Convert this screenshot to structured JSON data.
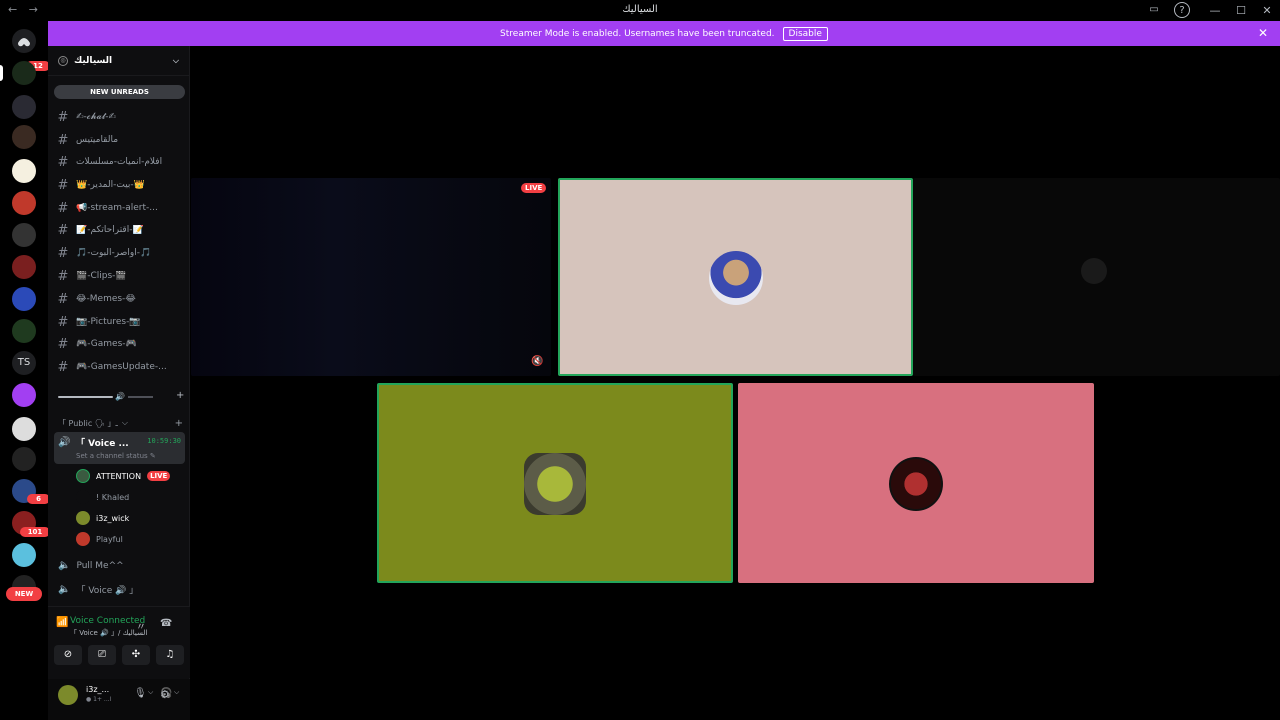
{
  "window": {
    "title": "السياليك",
    "nav_icons": "← →",
    "controls": [
      "—",
      "☐",
      "✕"
    ]
  },
  "banner": {
    "text": "Streamer Mode is enabled. Usernames have been truncated.",
    "disable_label": "Disable",
    "close": "✕",
    "color": "#a23ff2"
  },
  "server_list": {
    "badges": [
      "12",
      "6",
      "101"
    ],
    "ts_label": "TS",
    "new_label": "NEW"
  },
  "guild": {
    "name": "السياليك",
    "new_unreads": "NEW UNREADS"
  },
  "channels": [
    {
      "name": "✍-𝓬𝓱𝓪𝓽-✍"
    },
    {
      "name": "مالقاميتيس"
    },
    {
      "name": "أفلام-انميات-مسلسلات"
    },
    {
      "name": "👑-بيت-المدير-👑"
    },
    {
      "name": "📢-stream-alert-..."
    },
    {
      "name": "📝-اقتراحاتكم-📝"
    },
    {
      "name": "🎵-اواصر-البوت-🎵"
    },
    {
      "name": "🎬-Clips-🎬"
    },
    {
      "name": "😂-Memes-😂"
    },
    {
      "name": "📷-Pictures-📷"
    },
    {
      "name": "🎮-Games-🎮"
    },
    {
      "name": "🎮-GamesUpdate-..."
    }
  ],
  "category": {
    "name": "「 Public 🗣 」ـ"
  },
  "voice_channel": {
    "name": "「 Voice ...",
    "timer": "10:59:30",
    "status": "Set a channel status ✎"
  },
  "members": [
    {
      "name": "ATTENTION",
      "live": "LIVE",
      "color": "#3a5a40"
    },
    {
      "name": "! Khaled",
      "live": "",
      "color": "#0e0e10"
    },
    {
      "name": "i3z_wick",
      "live": "",
      "color": "#7c8a2b"
    },
    {
      "name": "Playful",
      "live": "",
      "color": "#c0392b"
    }
  ],
  "other_voice": [
    {
      "name": "Pull Me^^"
    },
    {
      "name": "「 Voice 🔊 」"
    }
  ],
  "voice_connected": {
    "title": "Voice Connected",
    "subtitle": "「 Voice 🔊 」/ السياليك"
  },
  "user": {
    "name": "i3z_...",
    "status": "● ا... +1"
  },
  "stage": {
    "live_label": "LIVE",
    "tiles": [
      {
        "bg": "#d6c4bc",
        "active": true
      },
      {
        "bg": "#7c8a1c",
        "active": true
      },
      {
        "bg": "#d8707f",
        "active": false
      }
    ]
  }
}
